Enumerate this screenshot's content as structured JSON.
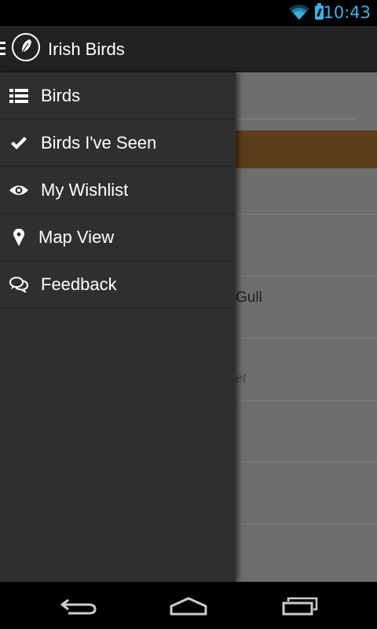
{
  "status_bar": {
    "time": "10:43",
    "wifi_icon": "wifi-icon",
    "battery_icon": "battery-charging-icon",
    "accent_color": "#33b5e5"
  },
  "action_bar": {
    "title": "Irish Birds",
    "logo_icon": "feather-icon",
    "drawer_icon": "drawer-indicator-icon"
  },
  "drawer": {
    "items": [
      {
        "label": "Birds",
        "icon": "list-icon"
      },
      {
        "label": "Birds I've Seen",
        "icon": "checkmark-icon"
      },
      {
        "label": "My Wishlist",
        "icon": "eye-icon"
      },
      {
        "label": "Map View",
        "icon": "map-pin-icon"
      },
      {
        "label": "Feedback",
        "icon": "chat-bubbles-icon"
      }
    ]
  },
  "content": {
    "banner_color": "#5c3e1a",
    "visible_fragments": [
      "Gull",
      "et"
    ]
  },
  "nav_bar": {
    "back_icon": "back-icon",
    "home_icon": "home-icon",
    "recents_icon": "recents-icon"
  }
}
